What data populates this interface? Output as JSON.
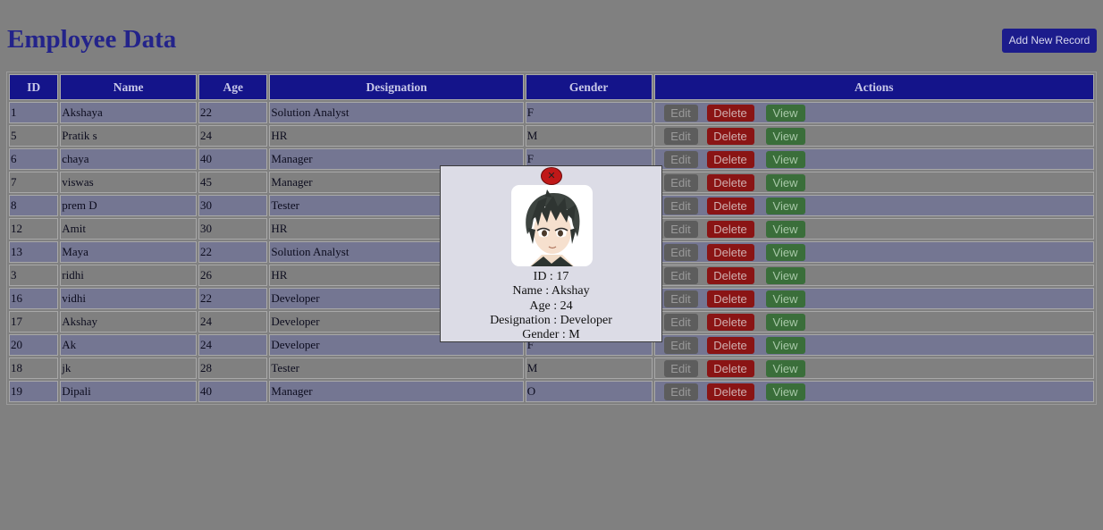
{
  "page": {
    "title": "Employee Data",
    "add_button_label": "Add New Record"
  },
  "table": {
    "headers": [
      "ID",
      "Name",
      "Age",
      "Designation",
      "Gender",
      "Actions"
    ],
    "rows": [
      {
        "id": "1",
        "name": "Akshaya",
        "age": "22",
        "designation": "Solution Analyst",
        "gender": "F"
      },
      {
        "id": "5",
        "name": "Pratik s",
        "age": "24",
        "designation": "HR",
        "gender": "M"
      },
      {
        "id": "6",
        "name": "chaya",
        "age": "40",
        "designation": "Manager",
        "gender": "F"
      },
      {
        "id": "7",
        "name": "viswas",
        "age": "45",
        "designation": "Manager",
        "gender": ""
      },
      {
        "id": "8",
        "name": "prem D",
        "age": "30",
        "designation": "Tester",
        "gender": ""
      },
      {
        "id": "12",
        "name": "Amit",
        "age": "30",
        "designation": "HR",
        "gender": ""
      },
      {
        "id": "13",
        "name": "Maya",
        "age": "22",
        "designation": "Solution Analyst",
        "gender": ""
      },
      {
        "id": "3",
        "name": "ridhi",
        "age": "26",
        "designation": "HR",
        "gender": ""
      },
      {
        "id": "16",
        "name": "vidhi",
        "age": "22",
        "designation": "Developer",
        "gender": ""
      },
      {
        "id": "17",
        "name": "Akshay",
        "age": "24",
        "designation": "Developer",
        "gender": ""
      },
      {
        "id": "20",
        "name": "Ak",
        "age": "24",
        "designation": "Developer",
        "gender": "F"
      },
      {
        "id": "18",
        "name": "jk",
        "age": "28",
        "designation": "Tester",
        "gender": "M"
      },
      {
        "id": "19",
        "name": "Dipali",
        "age": "40",
        "designation": "Manager",
        "gender": "O"
      }
    ],
    "action_labels": {
      "edit": "Edit",
      "delete": "Delete",
      "view": "View"
    }
  },
  "modal": {
    "close_icon": "close-icon",
    "avatar": "anime-boy-avatar",
    "id_line": "ID : 17",
    "name_line": "Name : Akshay",
    "age_line": "Age : 24",
    "designation_line": "Designation : Developer",
    "gender_line": "Gender : M"
  },
  "colors": {
    "overlay": "#808080",
    "title": "#23238a",
    "header_bg": "#14148a",
    "edit_button": "#5d5d5d",
    "delete_button": "#8a1414",
    "view_button": "#3a6e3a",
    "modal_bg": "#dcdce6"
  }
}
